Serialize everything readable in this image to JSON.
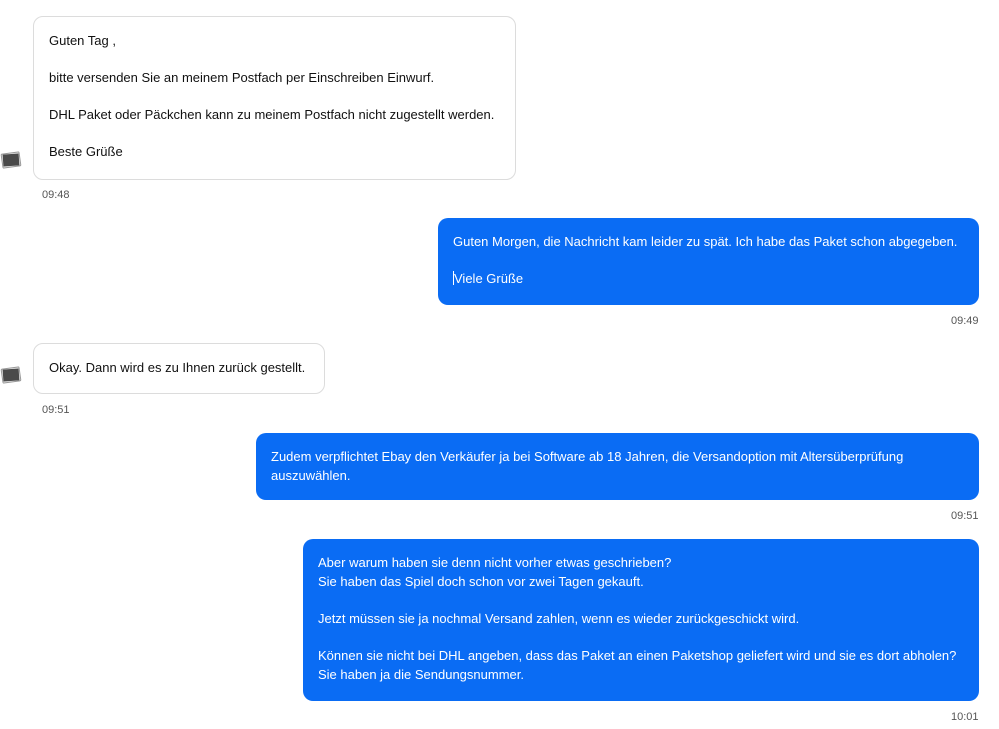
{
  "messages": [
    {
      "direction": "incoming",
      "lines": [
        "Guten Tag ,",
        "",
        "bitte versenden Sie an meinem Postfach per Einschreiben Einwurf.",
        "",
        "DHL Paket oder Päckchen kann zu meinem Postfach nicht zugestellt werden.",
        "",
        "Beste Grüße"
      ],
      "time": "09:48"
    },
    {
      "direction": "outgoing",
      "lines": [
        "Guten Morgen, die Nachricht kam leider zu spät. Ich habe das Paket schon abgegeben.",
        "",
        "Viele Grüße"
      ],
      "time": "09:49"
    },
    {
      "direction": "incoming",
      "lines": [
        "Okay. Dann wird es zu Ihnen zurück gestellt."
      ],
      "time": "09:51"
    },
    {
      "direction": "outgoing",
      "lines": [
        "Zudem verpflichtet Ebay den Verkäufer ja bei Software ab 18 Jahren, die Versandoption mit Altersüberprüfung",
        "auszuwählen."
      ],
      "time": "09:51"
    },
    {
      "direction": "outgoing",
      "lines": [
        "Aber warum haben sie denn nicht vorher etwas geschrieben?",
        "Sie haben das Spiel doch schon vor zwei Tagen gekauft.",
        "",
        "Jetzt müssen sie ja nochmal Versand zahlen, wenn es wieder zurückgeschickt wird.",
        "",
        "Können sie nicht bei DHL angeben, dass das Paket an einen Paketshop geliefert wird und sie es dort abholen?",
        "Sie haben ja die Sendungsnummer."
      ],
      "time": "10:01"
    }
  ],
  "colors": {
    "outgoing_bg": "#0a6cf4",
    "incoming_border": "#dcdcdc"
  },
  "icons": {
    "avatar": "photo-placeholder-icon"
  }
}
